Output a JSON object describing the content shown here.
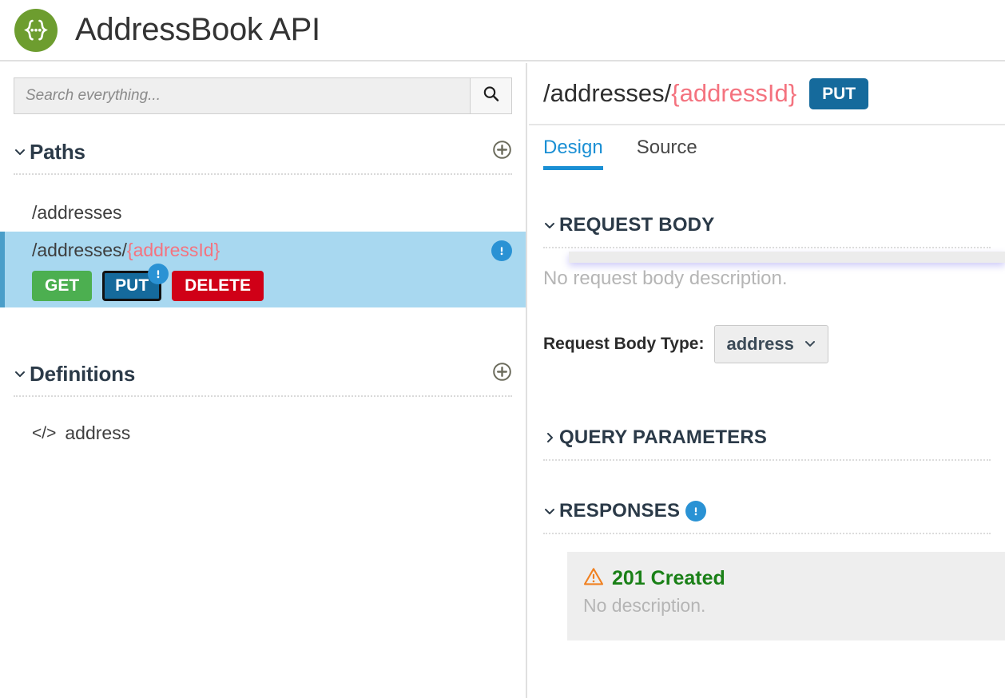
{
  "header": {
    "title": "AddressBook API",
    "logo_icon": "swagger-braces-icon",
    "logo_color": "#6d9d2f"
  },
  "sidebar": {
    "search": {
      "placeholder": "Search everything...",
      "value": "",
      "button_icon": "search-icon"
    },
    "sections": [
      {
        "id": "paths",
        "title": "Paths",
        "caret_icon": "chevron-down-icon",
        "expanded": true,
        "add_icon": "circle-plus-icon",
        "items": [
          {
            "label": "/addresses",
            "prefix": "/addresses",
            "param": "",
            "selected": false,
            "has_info": false,
            "methods": []
          },
          {
            "label": "/addresses/{addressId}",
            "prefix": "/addresses/",
            "param": "{addressId}",
            "selected": true,
            "has_info": true,
            "info_icon": "info-exclamation-icon",
            "methods": [
              {
                "label": "GET",
                "color": "#4caf50",
                "selected": false,
                "warn": false
              },
              {
                "label": "PUT",
                "color": "#156a9c",
                "selected": true,
                "warn": true,
                "warn_icon": "info-exclamation-icon"
              },
              {
                "label": "DELETE",
                "color": "#d00017",
                "selected": false,
                "warn": false
              }
            ]
          }
        ]
      },
      {
        "id": "definitions",
        "title": "Definitions",
        "caret_icon": "chevron-down-icon",
        "expanded": true,
        "add_icon": "circle-plus-icon",
        "items": [
          {
            "label": "address",
            "glyph": "</>",
            "icon": "code-brackets-icon"
          }
        ]
      }
    ]
  },
  "detail": {
    "path_prefix": "/addresses/",
    "path_param": "{addressId}",
    "method_badge": "PUT",
    "method_badge_color": "#156a9c",
    "tabs": [
      {
        "id": "design",
        "label": "Design",
        "active": true
      },
      {
        "id": "source",
        "label": "Source",
        "active": false
      }
    ],
    "sections": {
      "request_body": {
        "title": "REQUEST BODY",
        "caret_icon": "chevron-down-icon",
        "expanded": true,
        "description_placeholder": "No request body description.",
        "type_label": "Request Body Type:",
        "type_value": "address",
        "type_caret_icon": "chevron-down-icon"
      },
      "query_parameters": {
        "title": "QUERY PARAMETERS",
        "caret_icon": "chevron-right-icon",
        "expanded": false
      },
      "responses": {
        "title": "RESPONSES",
        "caret_icon": "chevron-down-icon",
        "expanded": true,
        "info_icon": "info-exclamation-icon",
        "items": [
          {
            "code": "201 Created",
            "code_color": "#1a8017",
            "warn_icon": "warning-triangle-icon",
            "description_placeholder": "No description."
          }
        ]
      }
    }
  },
  "colors": {
    "accent_blue": "#1a8fd4",
    "selected_row": "#a8d8f0",
    "selected_row_bar": "#4a9ec9",
    "param_pink": "#f4737f",
    "get_green": "#4caf50",
    "put_blue": "#156a9c",
    "delete_red": "#d00017",
    "warn_orange": "#f08020",
    "ok_green": "#1a8017"
  }
}
